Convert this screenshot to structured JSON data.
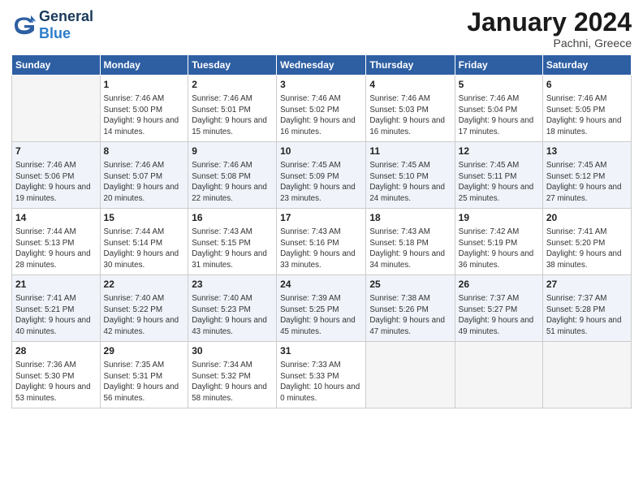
{
  "header": {
    "logo_text_general": "General",
    "logo_text_blue": "Blue",
    "title": "January 2024",
    "location": "Pachni, Greece"
  },
  "days_of_week": [
    "Sunday",
    "Monday",
    "Tuesday",
    "Wednesday",
    "Thursday",
    "Friday",
    "Saturday"
  ],
  "weeks": [
    [
      {
        "day": "",
        "empty": true
      },
      {
        "day": "1",
        "sunrise": "Sunrise: 7:46 AM",
        "sunset": "Sunset: 5:00 PM",
        "daylight": "Daylight: 9 hours and 14 minutes."
      },
      {
        "day": "2",
        "sunrise": "Sunrise: 7:46 AM",
        "sunset": "Sunset: 5:01 PM",
        "daylight": "Daylight: 9 hours and 15 minutes."
      },
      {
        "day": "3",
        "sunrise": "Sunrise: 7:46 AM",
        "sunset": "Sunset: 5:02 PM",
        "daylight": "Daylight: 9 hours and 16 minutes."
      },
      {
        "day": "4",
        "sunrise": "Sunrise: 7:46 AM",
        "sunset": "Sunset: 5:03 PM",
        "daylight": "Daylight: 9 hours and 16 minutes."
      },
      {
        "day": "5",
        "sunrise": "Sunrise: 7:46 AM",
        "sunset": "Sunset: 5:04 PM",
        "daylight": "Daylight: 9 hours and 17 minutes."
      },
      {
        "day": "6",
        "sunrise": "Sunrise: 7:46 AM",
        "sunset": "Sunset: 5:05 PM",
        "daylight": "Daylight: 9 hours and 18 minutes."
      }
    ],
    [
      {
        "day": "7",
        "sunrise": "Sunrise: 7:46 AM",
        "sunset": "Sunset: 5:06 PM",
        "daylight": "Daylight: 9 hours and 19 minutes."
      },
      {
        "day": "8",
        "sunrise": "Sunrise: 7:46 AM",
        "sunset": "Sunset: 5:07 PM",
        "daylight": "Daylight: 9 hours and 20 minutes."
      },
      {
        "day": "9",
        "sunrise": "Sunrise: 7:46 AM",
        "sunset": "Sunset: 5:08 PM",
        "daylight": "Daylight: 9 hours and 22 minutes."
      },
      {
        "day": "10",
        "sunrise": "Sunrise: 7:45 AM",
        "sunset": "Sunset: 5:09 PM",
        "daylight": "Daylight: 9 hours and 23 minutes."
      },
      {
        "day": "11",
        "sunrise": "Sunrise: 7:45 AM",
        "sunset": "Sunset: 5:10 PM",
        "daylight": "Daylight: 9 hours and 24 minutes."
      },
      {
        "day": "12",
        "sunrise": "Sunrise: 7:45 AM",
        "sunset": "Sunset: 5:11 PM",
        "daylight": "Daylight: 9 hours and 25 minutes."
      },
      {
        "day": "13",
        "sunrise": "Sunrise: 7:45 AM",
        "sunset": "Sunset: 5:12 PM",
        "daylight": "Daylight: 9 hours and 27 minutes."
      }
    ],
    [
      {
        "day": "14",
        "sunrise": "Sunrise: 7:44 AM",
        "sunset": "Sunset: 5:13 PM",
        "daylight": "Daylight: 9 hours and 28 minutes."
      },
      {
        "day": "15",
        "sunrise": "Sunrise: 7:44 AM",
        "sunset": "Sunset: 5:14 PM",
        "daylight": "Daylight: 9 hours and 30 minutes."
      },
      {
        "day": "16",
        "sunrise": "Sunrise: 7:43 AM",
        "sunset": "Sunset: 5:15 PM",
        "daylight": "Daylight: 9 hours and 31 minutes."
      },
      {
        "day": "17",
        "sunrise": "Sunrise: 7:43 AM",
        "sunset": "Sunset: 5:16 PM",
        "daylight": "Daylight: 9 hours and 33 minutes."
      },
      {
        "day": "18",
        "sunrise": "Sunrise: 7:43 AM",
        "sunset": "Sunset: 5:18 PM",
        "daylight": "Daylight: 9 hours and 34 minutes."
      },
      {
        "day": "19",
        "sunrise": "Sunrise: 7:42 AM",
        "sunset": "Sunset: 5:19 PM",
        "daylight": "Daylight: 9 hours and 36 minutes."
      },
      {
        "day": "20",
        "sunrise": "Sunrise: 7:41 AM",
        "sunset": "Sunset: 5:20 PM",
        "daylight": "Daylight: 9 hours and 38 minutes."
      }
    ],
    [
      {
        "day": "21",
        "sunrise": "Sunrise: 7:41 AM",
        "sunset": "Sunset: 5:21 PM",
        "daylight": "Daylight: 9 hours and 40 minutes."
      },
      {
        "day": "22",
        "sunrise": "Sunrise: 7:40 AM",
        "sunset": "Sunset: 5:22 PM",
        "daylight": "Daylight: 9 hours and 42 minutes."
      },
      {
        "day": "23",
        "sunrise": "Sunrise: 7:40 AM",
        "sunset": "Sunset: 5:23 PM",
        "daylight": "Daylight: 9 hours and 43 minutes."
      },
      {
        "day": "24",
        "sunrise": "Sunrise: 7:39 AM",
        "sunset": "Sunset: 5:25 PM",
        "daylight": "Daylight: 9 hours and 45 minutes."
      },
      {
        "day": "25",
        "sunrise": "Sunrise: 7:38 AM",
        "sunset": "Sunset: 5:26 PM",
        "daylight": "Daylight: 9 hours and 47 minutes."
      },
      {
        "day": "26",
        "sunrise": "Sunrise: 7:37 AM",
        "sunset": "Sunset: 5:27 PM",
        "daylight": "Daylight: 9 hours and 49 minutes."
      },
      {
        "day": "27",
        "sunrise": "Sunrise: 7:37 AM",
        "sunset": "Sunset: 5:28 PM",
        "daylight": "Daylight: 9 hours and 51 minutes."
      }
    ],
    [
      {
        "day": "28",
        "sunrise": "Sunrise: 7:36 AM",
        "sunset": "Sunset: 5:30 PM",
        "daylight": "Daylight: 9 hours and 53 minutes."
      },
      {
        "day": "29",
        "sunrise": "Sunrise: 7:35 AM",
        "sunset": "Sunset: 5:31 PM",
        "daylight": "Daylight: 9 hours and 56 minutes."
      },
      {
        "day": "30",
        "sunrise": "Sunrise: 7:34 AM",
        "sunset": "Sunset: 5:32 PM",
        "daylight": "Daylight: 9 hours and 58 minutes."
      },
      {
        "day": "31",
        "sunrise": "Sunrise: 7:33 AM",
        "sunset": "Sunset: 5:33 PM",
        "daylight": "Daylight: 10 hours and 0 minutes."
      },
      {
        "day": "",
        "empty": true
      },
      {
        "day": "",
        "empty": true
      },
      {
        "day": "",
        "empty": true
      }
    ]
  ]
}
